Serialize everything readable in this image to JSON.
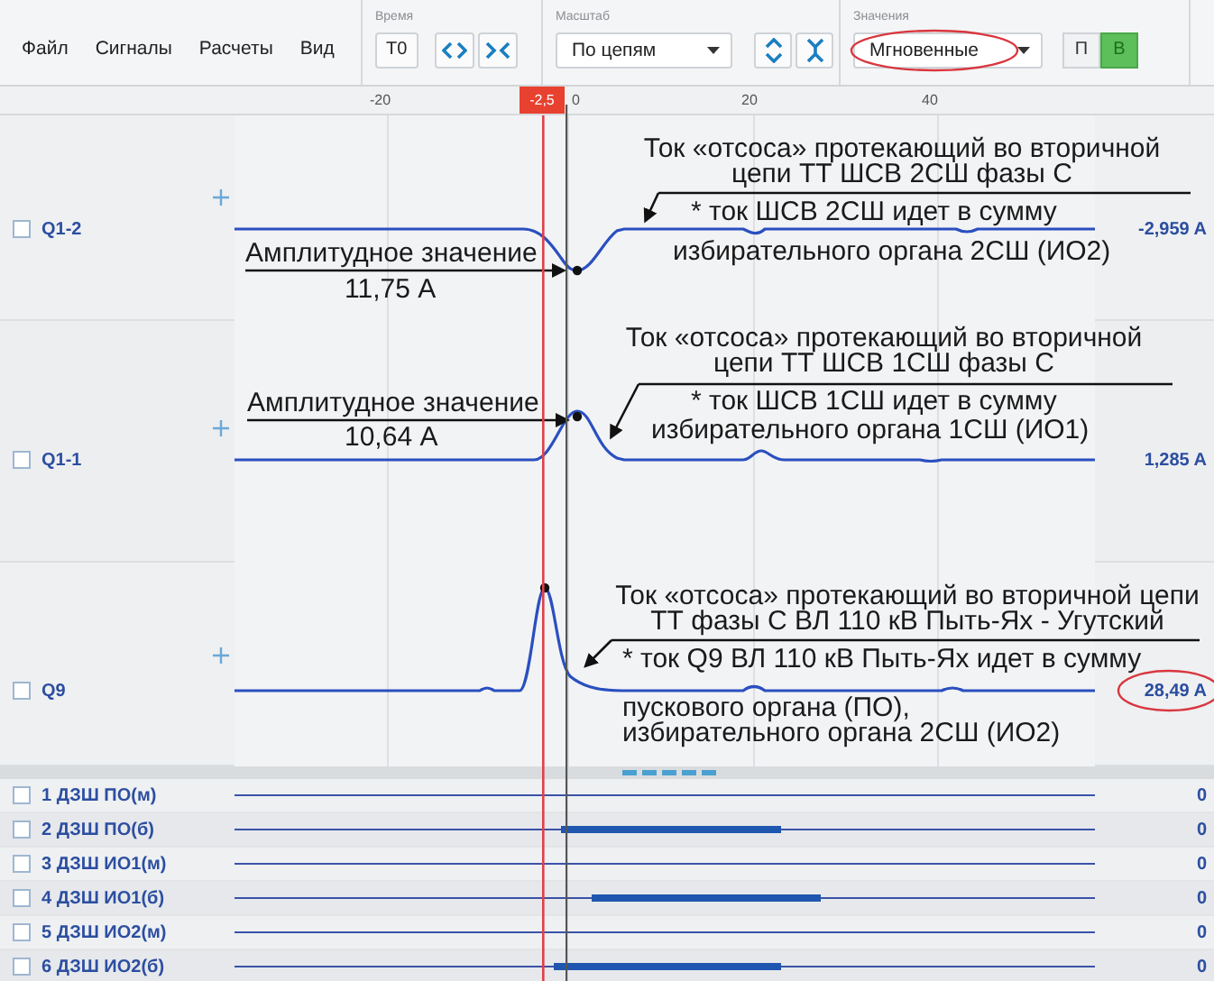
{
  "menu": [
    {
      "label": "Файл"
    },
    {
      "label": "Сигналы"
    },
    {
      "label": "Расчеты"
    },
    {
      "label": "Вид"
    }
  ],
  "toolbar": [
    {
      "title": "Время",
      "controls": [
        {
          "kind": "button",
          "label": "T0"
        },
        {
          "kind": "expand"
        },
        {
          "kind": "collapse"
        }
      ]
    },
    {
      "title": "Масштаб",
      "controls": [
        {
          "kind": "dropdown",
          "value": "По цепям",
          "circled": false
        },
        {
          "kind": "stretch"
        },
        {
          "kind": "squeeze"
        }
      ]
    },
    {
      "title": "Значения",
      "controls": [
        {
          "kind": "dropdown",
          "value": "Мгновенные",
          "circled": true
        },
        {
          "kind": "toggle",
          "label": "П",
          "selected": false
        },
        {
          "kind": "toggle",
          "label": "В",
          "selected": true
        }
      ]
    }
  ],
  "ruler": {
    "ticks": [
      "-20",
      "0",
      "20",
      "40"
    ],
    "cursor_label": "-2,5"
  },
  "analog_channels": [
    {
      "name": "Q1-2",
      "checked": false,
      "value": "-2,959 A",
      "note_title": [
        "Ток «отсоса» протекающий во вторичной",
        "цепи ТТ ШСВ 2СШ фазы С"
      ],
      "note_details": [
        "* ток ШСВ 2СШ идет в сумму",
        "избирательного органа 2СШ (ИО2)"
      ],
      "amplitude": {
        "label": "Амплитудное значение",
        "value": "11,75 А"
      }
    },
    {
      "name": "Q1-1",
      "checked": false,
      "value": "1,285 A",
      "note_title": [
        "Ток «отсоса» протекающий во вторичной",
        "цепи ТТ  ШСВ 1СШ фазы С"
      ],
      "note_details": [
        "* ток ШСВ 1СШ идет в сумму",
        "избирательного органа 1СШ (ИО1)"
      ],
      "amplitude": {
        "label": "Амплитудное значение",
        "value": "10,64 А"
      }
    },
    {
      "name": "Q9",
      "checked": false,
      "value": "28,49 A",
      "circled": true,
      "note_title": [
        "Ток «отсоса» протекающий во вторичной цепи",
        "ТТ фазы С ВЛ 110 кВ Пыть-Ях - Угутский"
      ],
      "note_details": [
        "* ток Q9 ВЛ 110 кВ Пыть-Ях идет в сумму",
        "пускового органа (ПО),",
        "избирательного органа 2СШ (ИО2)"
      ]
    }
  ],
  "digital_channels": [
    {
      "name": "1 ДЗШ ПО(м)",
      "checked": false,
      "value": "0"
    },
    {
      "name": "2 ДЗШ ПО(б)",
      "checked": false,
      "value": "0"
    },
    {
      "name": "3 ДЗШ ИО1(м)",
      "checked": false,
      "value": "0"
    },
    {
      "name": "4 ДЗШ ИО1(б)",
      "checked": false,
      "value": "0"
    },
    {
      "name": "5 ДЗШ ИО2(м)",
      "checked": false,
      "value": "0"
    },
    {
      "name": "6 ДЗШ ИО2(б)",
      "checked": false,
      "value": "0"
    }
  ]
}
